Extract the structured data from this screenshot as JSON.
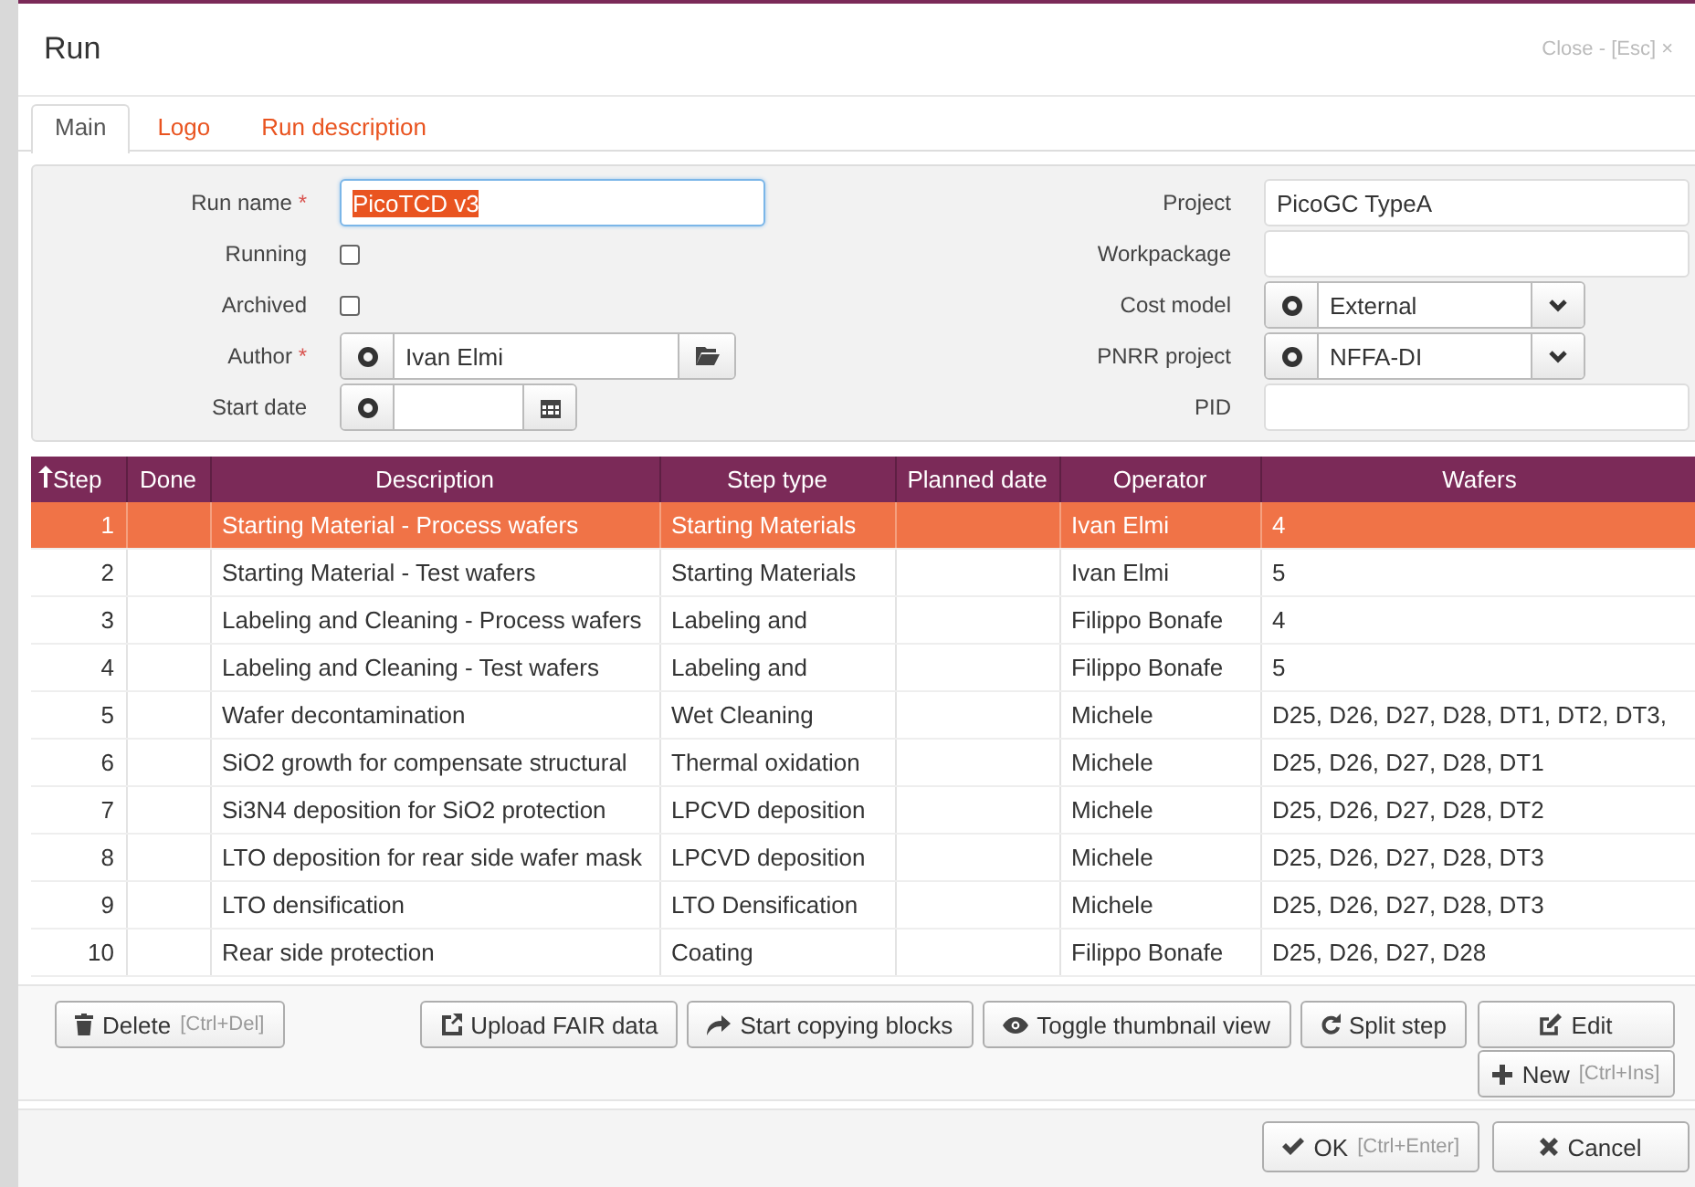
{
  "window": {
    "title": "Run",
    "close": "Close - [Esc] ×"
  },
  "tabs": [
    {
      "label": "Main",
      "selected": true
    },
    {
      "label": "Logo",
      "selected": false
    },
    {
      "label": "Run description",
      "selected": false
    }
  ],
  "form": {
    "left": [
      {
        "kind": "text",
        "label": "Run name",
        "required_mark": "*",
        "value": "PicoTCD v3",
        "text_selected": true
      },
      {
        "kind": "checkbox",
        "label": "Running",
        "checked": false
      },
      {
        "kind": "checkbox",
        "label": "Archived",
        "checked": false
      },
      {
        "kind": "lookup",
        "label": "Author",
        "required_mark": "*",
        "value": "Ivan Elmi"
      },
      {
        "kind": "date",
        "label": "Start date"
      }
    ],
    "right": [
      {
        "kind": "text",
        "label": "Project",
        "value": "PicoGC TypeA"
      },
      {
        "kind": "text",
        "label": "Workpackage"
      },
      {
        "kind": "select",
        "label": "Cost model",
        "value": "External"
      },
      {
        "kind": "select",
        "label": "PNRR project",
        "value": "NFFA-DI"
      },
      {
        "kind": "text",
        "label": "PID"
      }
    ]
  },
  "table": {
    "columns": [
      {
        "label": "Step",
        "sorted": true
      },
      {
        "label": "Done",
        "sorted": false
      },
      {
        "label": "Description",
        "sorted": false
      },
      {
        "label": "Step type",
        "sorted": false
      },
      {
        "label": "Planned date",
        "sorted": false
      },
      {
        "label": "Operator",
        "sorted": false
      },
      {
        "label": "Wafers",
        "sorted": false
      }
    ],
    "rows": [
      {
        "step": "1",
        "description": "Starting Material - Process wafers",
        "step_type": "Starting Materials",
        "operator": "Ivan Elmi",
        "wafers": "4",
        "selected": true
      },
      {
        "step": "2",
        "description": "Starting Material - Test wafers",
        "step_type": "Starting Materials",
        "operator": "Ivan Elmi",
        "wafers": "5",
        "selected": false
      },
      {
        "step": "3",
        "description": "Labeling and Cleaning - Process wafers",
        "step_type": "Labeling and",
        "operator": "Filippo Bonafe",
        "wafers": "4",
        "selected": false
      },
      {
        "step": "4",
        "description": "Labeling and Cleaning - Test wafers",
        "step_type": "Labeling and",
        "operator": "Filippo Bonafe",
        "wafers": "5",
        "selected": false
      },
      {
        "step": "5",
        "description": "Wafer decontamination",
        "step_type": "Wet Cleaning",
        "operator": "Michele",
        "wafers": "D25, D26, D27, D28, DT1, DT2, DT3,",
        "selected": false
      },
      {
        "step": "6",
        "description": "SiO2 growth for compensate structural",
        "step_type": "Thermal oxidation",
        "operator": "Michele",
        "wafers": "D25, D26, D27, D28, DT1",
        "selected": false
      },
      {
        "step": "7",
        "description": "Si3N4 deposition for SiO2 protection",
        "step_type": "LPCVD deposition",
        "operator": "Michele",
        "wafers": "D25, D26, D27, D28, DT2",
        "selected": false
      },
      {
        "step": "8",
        "description": "LTO deposition for rear side wafer mask",
        "step_type": "LPCVD deposition",
        "operator": "Michele",
        "wafers": "D25, D26, D27, D28, DT3",
        "selected": false
      },
      {
        "step": "9",
        "description": "LTO densification",
        "step_type": "LTO Densification",
        "operator": "Michele",
        "wafers": "D25, D26, D27, D28, DT3",
        "selected": false
      },
      {
        "step": "10",
        "description": "Rear side protection",
        "step_type": "Coating",
        "operator": "Filippo Bonafe",
        "wafers": "D25, D26, D27, D28",
        "selected": false
      }
    ]
  },
  "toolbar": [
    {
      "kind": "delete",
      "label": "Delete",
      "shortcut": "[Ctrl+Del]"
    },
    {
      "kind": "upload",
      "label": "Upload FAIR data"
    },
    {
      "kind": "copy",
      "label": "Start copying blocks"
    },
    {
      "kind": "thumbnails",
      "label": "Toggle thumbnail view"
    },
    {
      "kind": "split",
      "label": "Split step"
    },
    {
      "kind": "edit",
      "label": "Edit"
    },
    {
      "kind": "new",
      "label": "New",
      "shortcut": "[Ctrl+Ins]"
    }
  ],
  "footer": [
    {
      "kind": "ok",
      "label": "OK",
      "shortcut": "[Ctrl+Enter]"
    },
    {
      "kind": "cancel",
      "label": "Cancel"
    }
  ]
}
